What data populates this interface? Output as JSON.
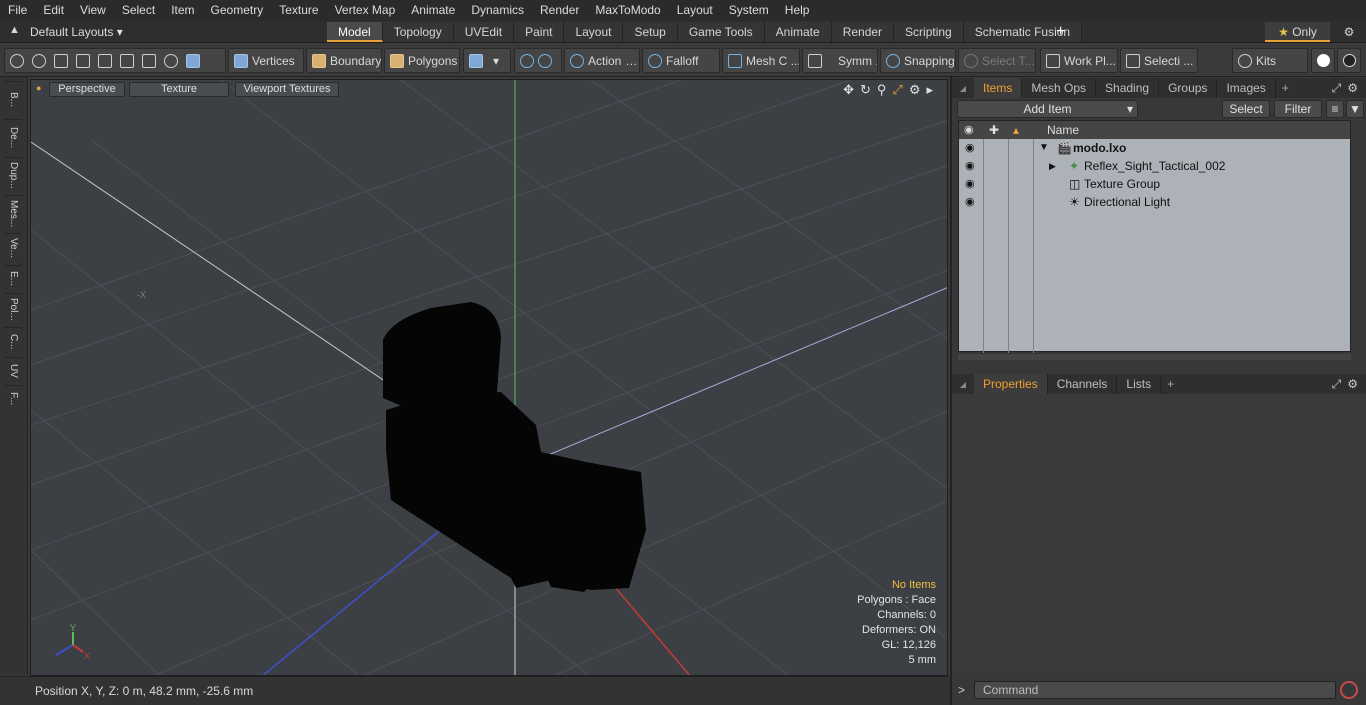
{
  "menu": [
    "File",
    "Edit",
    "View",
    "Select",
    "Item",
    "Geometry",
    "Texture",
    "Vertex Map",
    "Animate",
    "Dynamics",
    "Render",
    "MaxToModo",
    "Layout",
    "System",
    "Help"
  ],
  "layout_dropdown": "Default Layouts",
  "layout_tabs": [
    "Model",
    "Topology",
    "UVEdit",
    "Paint",
    "Layout",
    "Setup",
    "Game Tools",
    "Animate",
    "Render",
    "Scripting",
    "Schematic Fusion"
  ],
  "active_tab": "Model",
  "only_label": "Only",
  "toolbar": {
    "vertices": "Vertices",
    "boundary": "Boundary",
    "polygons": "Polygons",
    "action": "Action",
    "falloff": "Falloff",
    "mesh_c": "Mesh C ...",
    "symm": "Symm ...",
    "snapping": "Snapping",
    "select_t": "Select T...",
    "work_pl": "Work Pl...",
    "selecti": "Selecti ...",
    "kits": "Kits"
  },
  "left_tabs": [
    "B...",
    "De...",
    "Dup...",
    "Mes...",
    "Ve...",
    "E...",
    "Pol...",
    "C...",
    "UV",
    "F..."
  ],
  "viewport": {
    "perspective": "Perspective",
    "texture": "Texture",
    "viewport_textures": "Viewport Textures",
    "axis_y": "Y",
    "axis_x": "X",
    "neg_x_label": "-X",
    "hud": {
      "no_items": "No Items",
      "polygons": "Polygons : Face",
      "channels": "Channels: 0",
      "deformers": "Deformers: ON",
      "gl": "GL: 12,126",
      "scale": "5 mm"
    }
  },
  "status": {
    "position": "Position X, Y, Z:   0 m, 48.2 mm, -25.6 mm"
  },
  "items_panel": {
    "tabs": [
      "Items",
      "Mesh Ops",
      "Shading",
      "Groups",
      "Images"
    ],
    "active": "Items",
    "add_item": "Add Item",
    "select": "Select",
    "filter": "Filter",
    "column_name": "Name",
    "rows": [
      {
        "label": "modo.lxo"
      },
      {
        "label": "Reflex_Sight_Tactical_002"
      },
      {
        "label": "Texture Group"
      },
      {
        "label": "Directional Light"
      }
    ]
  },
  "properties_panel": {
    "tabs": [
      "Properties",
      "Channels",
      "Lists"
    ],
    "active": "Properties"
  },
  "command_placeholder": "Command",
  "colors": {
    "accent": "#e8a23a",
    "list_bg": "#adb2b8",
    "viewport_bg": "#3c4045"
  }
}
